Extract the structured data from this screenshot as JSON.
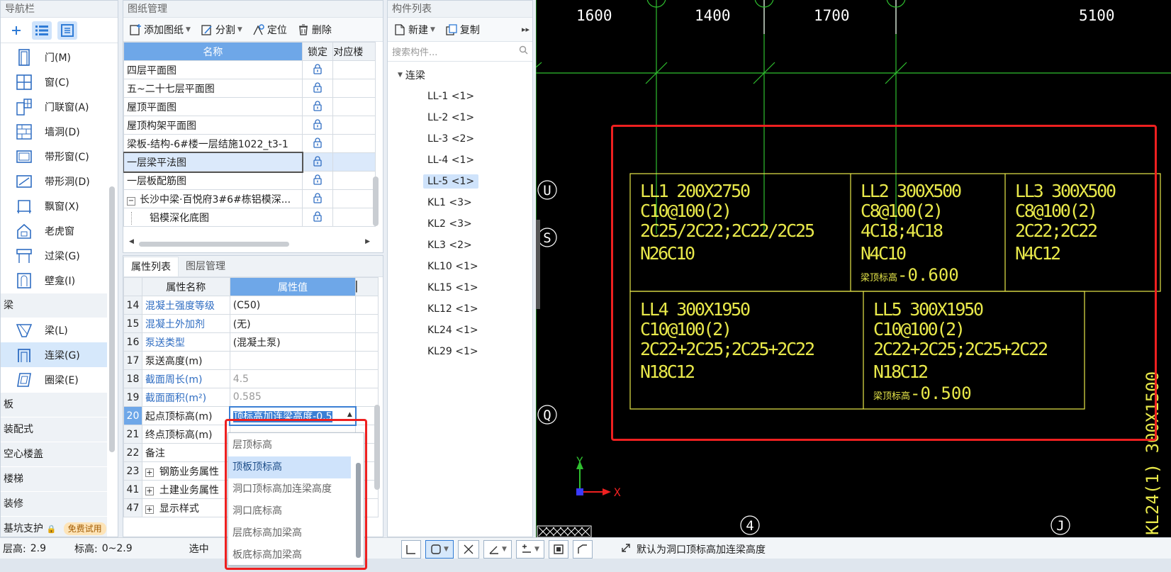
{
  "nav": {
    "title": "导航栏",
    "items": [
      {
        "label": "门(M)",
        "icon": "door-icon"
      },
      {
        "label": "窗(C)",
        "icon": "window-icon"
      },
      {
        "label": "门联窗(A)",
        "icon": "door-window-icon"
      },
      {
        "label": "墙洞(D)",
        "icon": "wall-opening-icon"
      },
      {
        "label": "带形窗(C)",
        "icon": "strip-window-icon"
      },
      {
        "label": "带形洞(D)",
        "icon": "strip-opening-icon"
      },
      {
        "label": "飘窗(X)",
        "icon": "bay-window-icon"
      },
      {
        "label": "老虎窗",
        "icon": "dormer-icon"
      },
      {
        "label": "过梁(G)",
        "icon": "lintel-icon"
      },
      {
        "label": "壁龛(I)",
        "icon": "niche-icon"
      }
    ],
    "cat_beam": "梁",
    "beam_items": [
      {
        "label": "梁(L)",
        "icon": "beam-icon"
      },
      {
        "label": "连梁(G)",
        "icon": "coupling-beam-icon"
      },
      {
        "label": "圈梁(E)",
        "icon": "ring-beam-icon"
      }
    ],
    "categories": [
      "板",
      "装配式",
      "空心楼盖",
      "楼梯",
      "装修"
    ],
    "last_category": "基坑支护",
    "free_badge": "免费试用"
  },
  "drawings": {
    "title": "图纸管理",
    "toolbar": {
      "add": "添加图纸",
      "split": "分割",
      "locate": "定位",
      "delete": "删除"
    },
    "columns": [
      "名称",
      "锁定",
      "对应楼"
    ],
    "rows": [
      "四层平面图",
      "五~二十七层平面图",
      "屋顶平面图",
      "屋顶构架平面图",
      "梁板-结构-6#楼一层结施1022_t3-1",
      "一层梁平法图",
      "一层板配筋图",
      "长沙中梁·百悦府3#6#栋铝模深...",
      "铝模深化底图"
    ],
    "expander": "−"
  },
  "props": {
    "tabs": [
      "属性列表",
      "图层管理"
    ],
    "columns": [
      "属性名称",
      "属性值"
    ],
    "rows": [
      {
        "no": "14",
        "name": "混凝土强度等级",
        "value": "(C50)"
      },
      {
        "no": "15",
        "name": "混凝土外加剂",
        "value": "(无)"
      },
      {
        "no": "16",
        "name": "泵送类型",
        "value": "(混凝土泵)"
      },
      {
        "no": "17",
        "name": "泵送高度(m)",
        "value": ""
      },
      {
        "no": "18",
        "name": "截面周长(m)",
        "value": "4.5"
      },
      {
        "no": "19",
        "name": "截面面积(m²)",
        "value": "0.585"
      },
      {
        "no": "20",
        "name": "起点顶标高(m)",
        "value": "顶标高加连梁高度-0.5"
      },
      {
        "no": "21",
        "name": "终点顶标高(m)",
        "value": ""
      },
      {
        "no": "22",
        "name": "备注",
        "value": ""
      },
      {
        "no": "23",
        "name": "钢筋业务属性",
        "value": ""
      },
      {
        "no": "41",
        "name": "土建业务属性",
        "value": ""
      },
      {
        "no": "47",
        "name": "显示样式",
        "value": ""
      }
    ]
  },
  "dropdown": {
    "options": [
      "层顶标高",
      "顶板顶标高",
      "洞口顶标高加连梁高度",
      "洞口底标高",
      "层底标高加梁高",
      "板底标高加梁高"
    ],
    "highlighted": "顶板顶标高"
  },
  "components": {
    "title": "构件列表",
    "toolbar": {
      "new": "新建",
      "copy": "复制"
    },
    "search_placeholder": "搜索构件...",
    "group": "连梁",
    "items": [
      "LL-1 <1>",
      "LL-2 <1>",
      "LL-3 <2>",
      "LL-4 <1>",
      "LL-5 <1>",
      "KL1 <3>",
      "KL2 <3>",
      "KL3 <2>",
      "KL10 <1>",
      "KL15 <1>",
      "KL12 <1>",
      "KL24 <1>",
      "KL29 <1>"
    ],
    "selected": "LL-5 <1>"
  },
  "cad": {
    "dims": [
      "1600",
      "1400",
      "1700",
      "5100"
    ],
    "axis_labels": [
      "U",
      "S",
      "Q"
    ],
    "bottom_axes": [
      "4",
      "J"
    ],
    "side_text": "KL24(1) 300X1500",
    "elev_prefix": "梁顶标高",
    "beams": [
      {
        "title": "LL1 200X2750",
        "l2": "C10@100(2)",
        "l3": "2C25/2C22;2C22/2C25",
        "l4": "N26C10",
        "l5": ""
      },
      {
        "title": "LL2 300X500",
        "l2": "C8@100(2)",
        "l3": "4C18;4C18",
        "l4": "N4C10",
        "l5": "-0.600"
      },
      {
        "title": "LL3 300X500",
        "l2": "C8@100(2)",
        "l3": "2C22;2C22",
        "l4": "N4C12",
        "l5": ""
      },
      {
        "title": "LL4 300X1950",
        "l2": "C10@100(2)",
        "l3": "2C22+2C25;2C25+2C22",
        "l4": "N18C12",
        "l5": ""
      },
      {
        "title": "LL5 300X1950",
        "l2": "C10@100(2)",
        "l3": "2C22+2C25;2C25+2C22",
        "l4": "N18C12",
        "l5": "-0.500"
      }
    ],
    "ucs_x": "X",
    "ucs_y": "Y"
  },
  "status": {
    "floor_height_label": "层高:",
    "floor_height": "2.9",
    "elev_label": "标高:",
    "elev": "0~2.9",
    "selected_label": "选中",
    "tooltip": "默认为洞口顶标高加连梁高度"
  },
  "colors": {
    "accent": "#6ea7e8",
    "cad_yellow": "#e8e84a",
    "cad_green": "#2fbf2f",
    "highlight_red": "#ee2020"
  }
}
